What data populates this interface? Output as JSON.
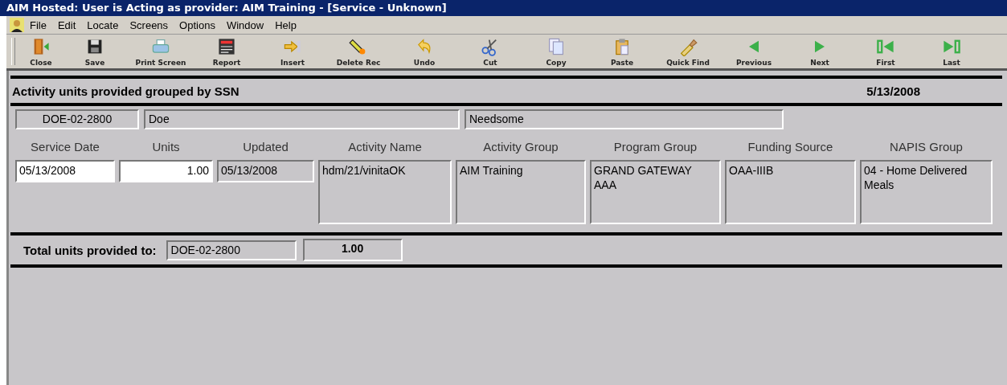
{
  "window": {
    "title": "AIM Hosted:  User is Acting as provider:  AIM Training - [Service - Unknown]"
  },
  "menu": [
    "File",
    "Edit",
    "Locate",
    "Screens",
    "Options",
    "Window",
    "Help"
  ],
  "toolbar": [
    {
      "label": "Close"
    },
    {
      "label": "Save"
    },
    {
      "label": "Print Screen"
    },
    {
      "label": "Report"
    },
    {
      "label": "Insert"
    },
    {
      "label": "Delete Rec"
    },
    {
      "label": "Undo"
    },
    {
      "label": "Cut"
    },
    {
      "label": "Copy"
    },
    {
      "label": "Paste"
    },
    {
      "label": "Quick Find"
    },
    {
      "label": "Previous"
    },
    {
      "label": "Next"
    },
    {
      "label": "First"
    },
    {
      "label": "Last"
    }
  ],
  "report": {
    "title": "Activity units provided grouped by SSN",
    "date": "5/13/2008",
    "client": [
      "DOE-02-2800",
      "Doe",
      "Needsome"
    ],
    "columns": [
      "Service Date",
      "Units",
      "Updated",
      "Activity Name",
      "Activity Group",
      "Program Group",
      "Funding Source",
      "NAPIS Group"
    ],
    "row": [
      {
        "value": "05/13/2008",
        "editable": true
      },
      {
        "value": "1.00",
        "editable": true
      },
      {
        "value": "05/13/2008",
        "editable": false
      },
      {
        "value": "hdm/21/vinitaOK",
        "editable": false
      },
      {
        "value": "AIM Training",
        "editable": false
      },
      {
        "value": "GRAND GATEWAY AAA",
        "editable": false
      },
      {
        "value": "OAA-IIIB",
        "editable": false
      },
      {
        "value": "04 - Home Delivered Meals",
        "editable": false
      }
    ],
    "total": {
      "label": "Total units provided to:",
      "ssn": "DOE-02-2800",
      "value": "1.00"
    }
  }
}
